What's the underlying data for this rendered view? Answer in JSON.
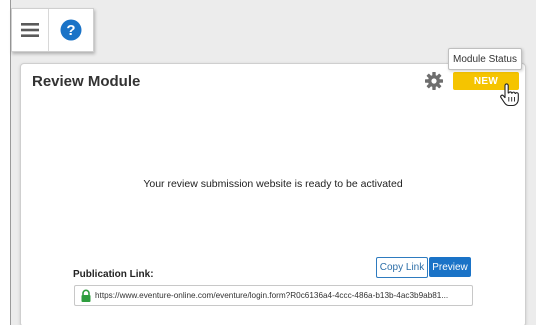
{
  "topbar": {
    "menu_icon": "hamburger-menu-icon",
    "help_icon": "help-question-icon",
    "help_color": "#1a73c7"
  },
  "card": {
    "title": "Review Module",
    "settings_icon": "gear-icon",
    "status_label": "NEW",
    "status_color": "#f5c400",
    "tooltip": "Module Status",
    "message": "Your review submission website is ready to be activated",
    "publication_label": "Publication Link:",
    "copy_link_label": "Copy Link",
    "preview_label": "Preview",
    "link_value": "https://www.eventure-online.com/eventure/login.form?R0c6136a4-4ccc-486a-b13b-4ac3b9ab81...",
    "lock_icon": "lock-icon",
    "lock_color": "#2e9e3e",
    "accent_color": "#1a73c7"
  }
}
